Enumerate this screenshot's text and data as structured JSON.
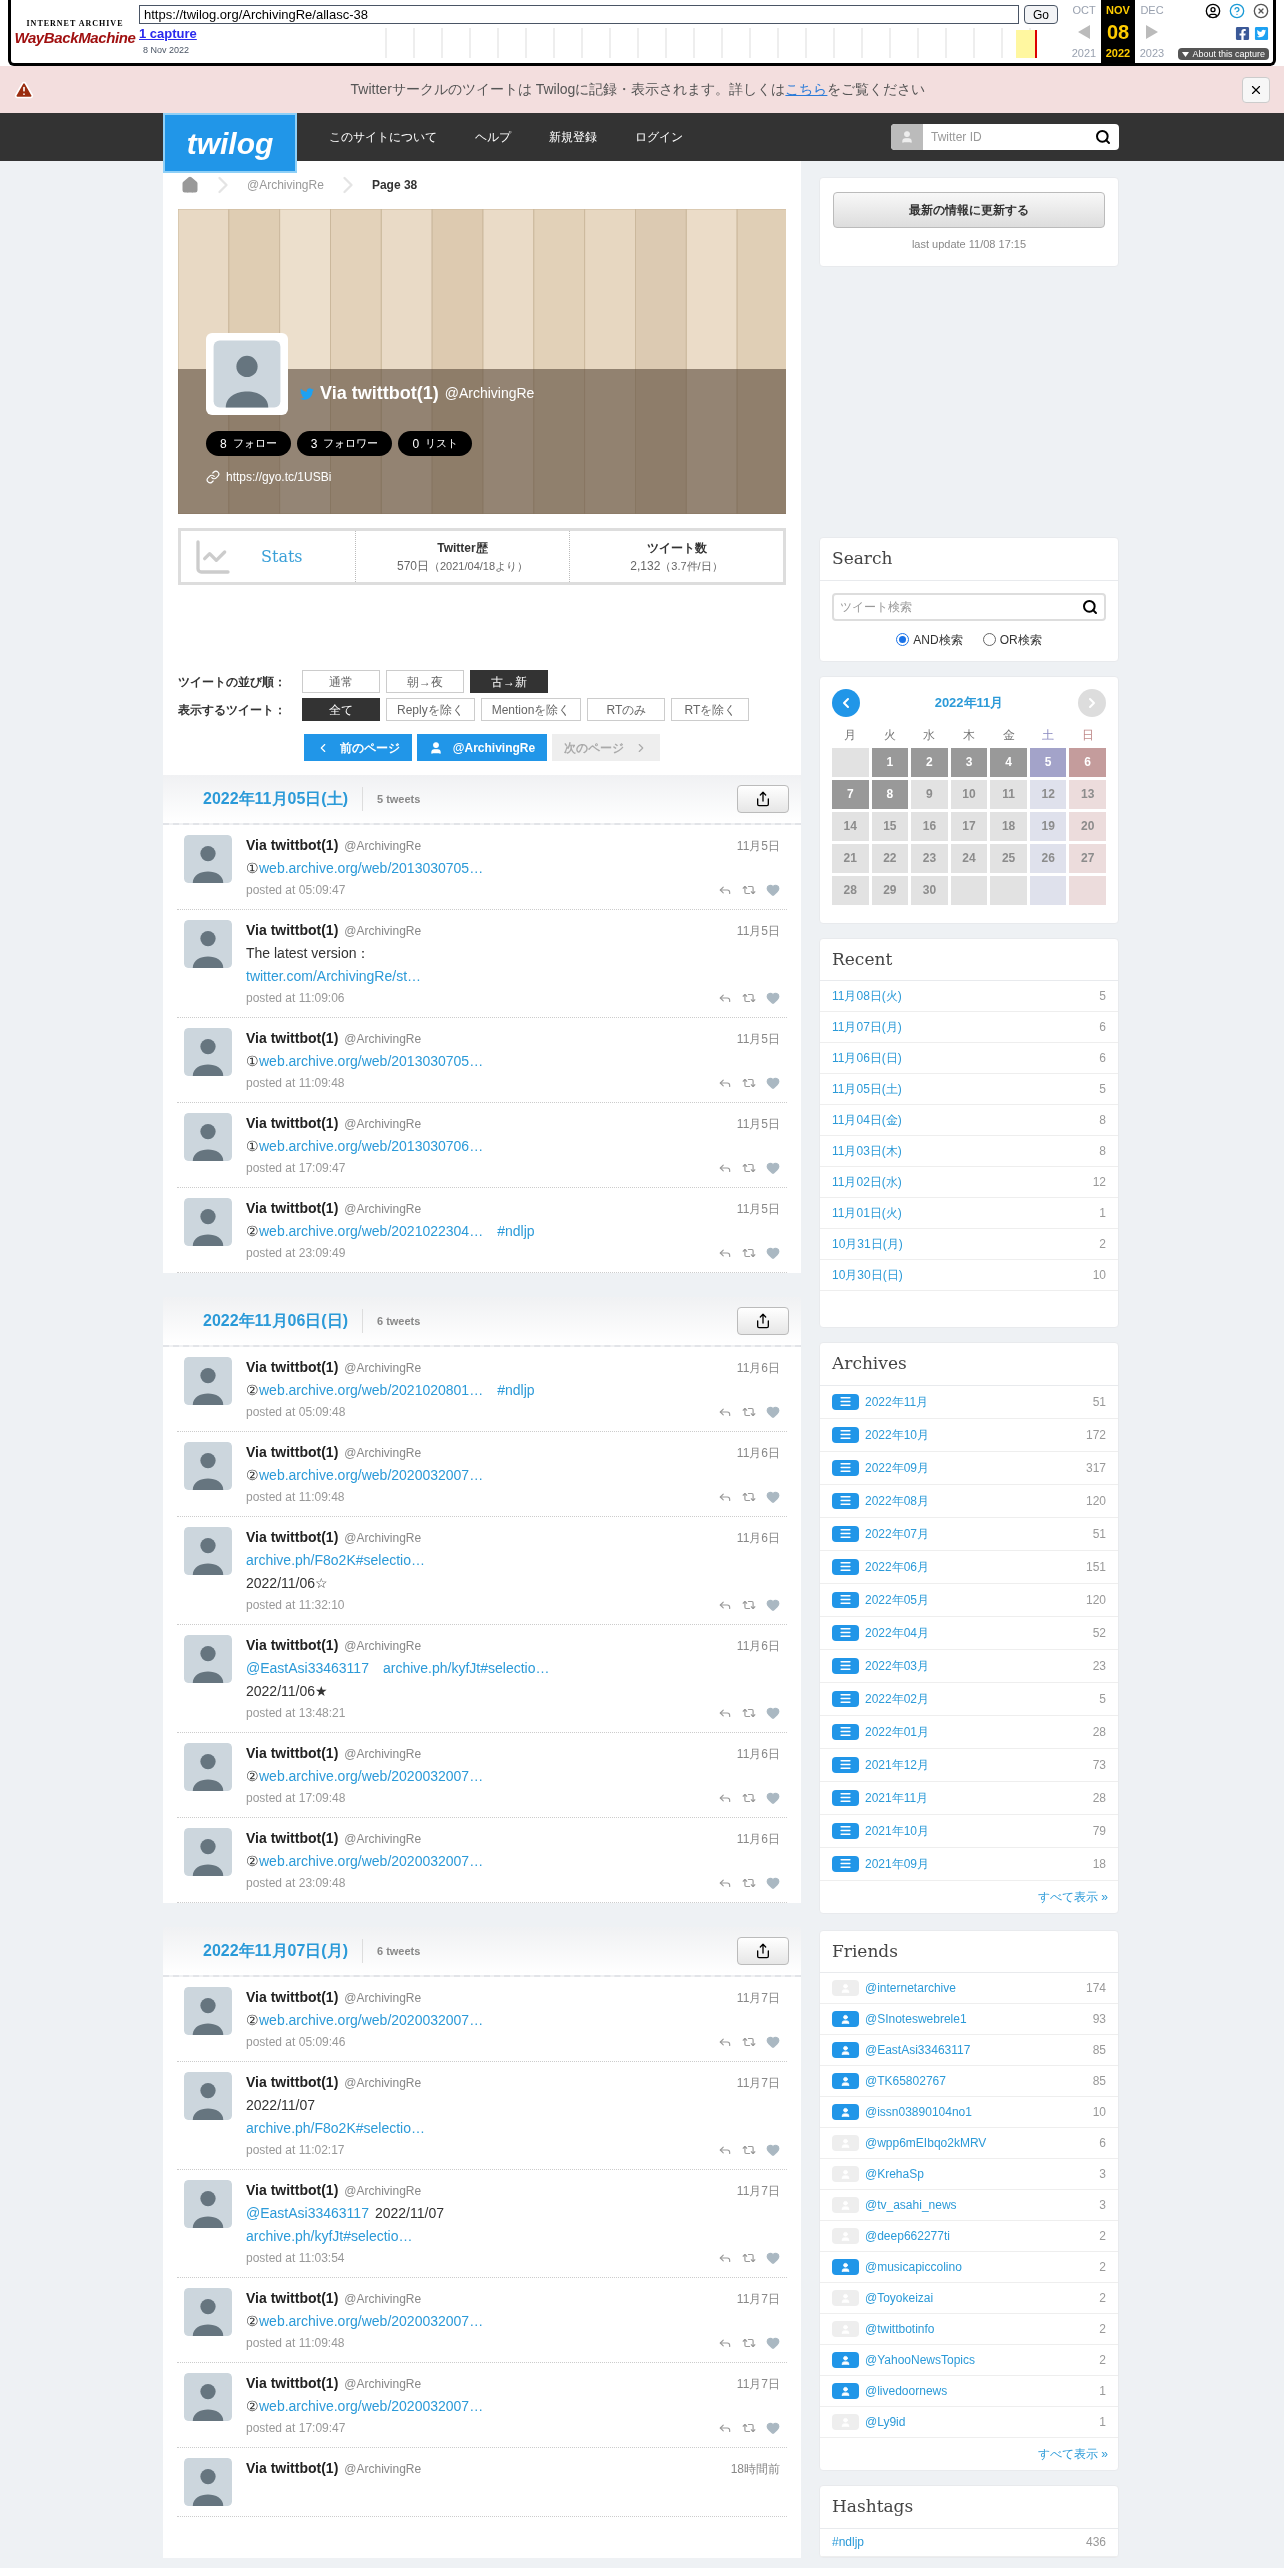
{
  "wayback": {
    "logo_top": "INTERNET ARCHIVE",
    "logo": "WayBackMachine",
    "url": "https://twilog.org/ArchivingRe/allasc-38",
    "go": "Go",
    "captures": "1 capture",
    "capture_date": "8 Nov 2022",
    "day": "08",
    "about": "About this capture",
    "months": [
      {
        "label": "OCT",
        "year": "2021",
        "selected": false
      },
      {
        "label": "NOV",
        "year": "2022",
        "selected": true
      },
      {
        "label": "DEC",
        "year": "2023",
        "selected": false
      }
    ]
  },
  "notice": {
    "before": "Twitterサークルのツイートは Twilogに記録・表示されます。詳しくは",
    "link": "こちら",
    "after": "をご覧ください"
  },
  "header": {
    "logo": "twilog",
    "nav": [
      "このサイトについて",
      "ヘルプ",
      "新規登録",
      "ログイン"
    ],
    "search_placeholder": "Twitter ID"
  },
  "breadcrumb": [
    "@ArchivingRe",
    "Page 38"
  ],
  "profile": {
    "name": "Via twittbot(1)",
    "handle": "@ArchivingRe",
    "url": "https://gyo.tc/1USBi",
    "counts": [
      {
        "value": "8",
        "label": "フォロー"
      },
      {
        "value": "3",
        "label": "フォロワー"
      },
      {
        "value": "0",
        "label": "リスト"
      }
    ]
  },
  "stats": {
    "title": "Stats",
    "items": [
      {
        "label": "Twitter歴",
        "value": "570日",
        "note": "（2021/04/18より）"
      },
      {
        "label": "ツイート数",
        "value": "2,132",
        "note": "（3.7件/日）"
      }
    ]
  },
  "sort": {
    "label": "ツイートの並び順：",
    "options": [
      {
        "label": "通常",
        "selected": false
      },
      {
        "label": "朝→夜",
        "selected": false
      },
      {
        "label": "古→新",
        "selected": true
      }
    ]
  },
  "filter": {
    "label": "表示するツイート：",
    "options": [
      {
        "label": "全て",
        "selected": true
      },
      {
        "label": "Replyを除く",
        "selected": false
      },
      {
        "label": "Mentionを除く",
        "selected": false
      },
      {
        "label": "RTのみ",
        "selected": false
      },
      {
        "label": "RTを除く",
        "selected": false
      }
    ]
  },
  "paging": [
    {
      "kind": "prev",
      "label": "前のページ",
      "disabled": false
    },
    {
      "kind": "user",
      "label": "@ArchivingRe",
      "disabled": false
    },
    {
      "kind": "next",
      "label": "次のページ",
      "disabled": true
    }
  ],
  "days": [
    {
      "date": "2022年11月05日(土)",
      "count": "5 tweets",
      "tweets": [
        {
          "name": "Via twittbot(1)",
          "handle": "@ArchivingRe",
          "date": "11月5日",
          "lines": [
            [
              {
                "text": "①",
                "link": false
              },
              {
                "text": "web.archive.org/web/2013030705…",
                "link": true
              }
            ]
          ],
          "time": "posted at 05:09:47"
        },
        {
          "name": "Via twittbot(1)",
          "handle": "@ArchivingRe",
          "date": "11月5日",
          "lines": [
            [
              {
                "text": "The latest version：",
                "link": false
              }
            ],
            [
              {
                "text": "twitter.com/ArchivingRe/st…",
                "link": true
              }
            ]
          ],
          "time": "posted at 11:09:06"
        },
        {
          "name": "Via twittbot(1)",
          "handle": "@ArchivingRe",
          "date": "11月5日",
          "lines": [
            [
              {
                "text": "①",
                "link": false
              },
              {
                "text": "web.archive.org/web/2013030705…",
                "link": true
              }
            ]
          ],
          "time": "posted at 11:09:48"
        },
        {
          "name": "Via twittbot(1)",
          "handle": "@ArchivingRe",
          "date": "11月5日",
          "lines": [
            [
              {
                "text": "①",
                "link": false
              },
              {
                "text": "web.archive.org/web/2013030706…",
                "link": true
              }
            ]
          ],
          "time": "posted at 17:09:47"
        },
        {
          "name": "Via twittbot(1)",
          "handle": "@ArchivingRe",
          "date": "11月5日",
          "lines": [
            [
              {
                "text": "②",
                "link": false
              },
              {
                "text": "web.archive.org/web/2021022304…",
                "link": true
              },
              {
                "text": "#ndljp",
                "link": true
              }
            ]
          ],
          "time": "posted at 23:09:49"
        }
      ]
    },
    {
      "date": "2022年11月06日(日)",
      "count": "6 tweets",
      "tweets": [
        {
          "name": "Via twittbot(1)",
          "handle": "@ArchivingRe",
          "date": "11月6日",
          "lines": [
            [
              {
                "text": "②",
                "link": false
              },
              {
                "text": "web.archive.org/web/2021020801…",
                "link": true
              },
              {
                "text": "#ndljp",
                "link": true
              }
            ]
          ],
          "time": "posted at 05:09:48"
        },
        {
          "name": "Via twittbot(1)",
          "handle": "@ArchivingRe",
          "date": "11月6日",
          "lines": [
            [
              {
                "text": "②",
                "link": false
              },
              {
                "text": "web.archive.org/web/2020032007…",
                "link": true
              }
            ]
          ],
          "time": "posted at 11:09:48"
        },
        {
          "name": "Via twittbot(1)",
          "handle": "@ArchivingRe",
          "date": "11月6日",
          "lines": [
            [
              {
                "text": "archive.ph/F8o2K#selectio…",
                "link": true
              }
            ],
            [
              {
                "text": "2022/11/06☆",
                "link": false
              }
            ]
          ],
          "time": "posted at 11:32:10"
        },
        {
          "name": "Via twittbot(1)",
          "handle": "@ArchivingRe",
          "date": "11月6日",
          "lines": [
            [
              {
                "text": "@EastAsi33463117",
                "link": true
              },
              {
                "text": "archive.ph/kyfJt#selectio…",
                "link": true
              }
            ],
            [
              {
                "text": "2022/11/06★",
                "link": false
              }
            ]
          ],
          "time": "posted at 13:48:21"
        },
        {
          "name": "Via twittbot(1)",
          "handle": "@ArchivingRe",
          "date": "11月6日",
          "lines": [
            [
              {
                "text": "②",
                "link": false
              },
              {
                "text": "web.archive.org/web/2020032007…",
                "link": true
              }
            ]
          ],
          "time": "posted at 17:09:48"
        },
        {
          "name": "Via twittbot(1)",
          "handle": "@ArchivingRe",
          "date": "11月6日",
          "lines": [
            [
              {
                "text": "②",
                "link": false
              },
              {
                "text": "web.archive.org/web/2020032007…",
                "link": true
              }
            ]
          ],
          "time": "posted at 23:09:48"
        }
      ]
    },
    {
      "date": "2022年11月07日(月)",
      "count": "6 tweets",
      "tweets": [
        {
          "name": "Via twittbot(1)",
          "handle": "@ArchivingRe",
          "date": "11月7日",
          "lines": [
            [
              {
                "text": "②",
                "link": false
              },
              {
                "text": "web.archive.org/web/2020032007…",
                "link": true
              }
            ]
          ],
          "time": "posted at 05:09:46"
        },
        {
          "name": "Via twittbot(1)",
          "handle": "@ArchivingRe",
          "date": "11月7日",
          "lines": [
            [
              {
                "text": "2022/11/07",
                "link": false
              }
            ],
            [
              {
                "text": "archive.ph/F8o2K#selectio…",
                "link": true
              }
            ]
          ],
          "time": "posted at 11:02:17"
        },
        {
          "name": "Via twittbot(1)",
          "handle": "@ArchivingRe",
          "date": "11月7日",
          "lines": [
            [
              {
                "text": "@EastAsi33463117",
                "link": true
              },
              {
                "text": "2022/11/07",
                "link": false
              }
            ],
            [
              {
                "text": "archive.ph/kyfJt#selectio…",
                "link": true
              }
            ]
          ],
          "time": "posted at 11:03:54"
        },
        {
          "name": "Via twittbot(1)",
          "handle": "@ArchivingRe",
          "date": "11月7日",
          "lines": [
            [
              {
                "text": "②",
                "link": false
              },
              {
                "text": "web.archive.org/web/2020032007…",
                "link": true
              }
            ]
          ],
          "time": "posted at 11:09:48"
        },
        {
          "name": "Via twittbot(1)",
          "handle": "@ArchivingRe",
          "date": "11月7日",
          "lines": [
            [
              {
                "text": "②",
                "link": false
              },
              {
                "text": "web.archive.org/web/2020032007…",
                "link": true
              }
            ]
          ],
          "time": "posted at 17:09:47"
        },
        {
          "name": "Via twittbot(1)",
          "handle": "@ArchivingRe",
          "date": "18時間前"
        }
      ]
    }
  ],
  "sidebar": {
    "refresh": {
      "button": "最新の情報に更新する",
      "note": "last update 11/08 17:15"
    },
    "search": {
      "title": "Search",
      "placeholder": "ツイート検索",
      "modes": [
        {
          "label": "AND検索",
          "selected": true
        },
        {
          "label": "OR検索",
          "selected": false
        }
      ]
    },
    "calendar": {
      "title": "2022年11月",
      "prev_disabled": false,
      "next_disabled": true,
      "weekdays": [
        "月",
        "火",
        "水",
        "木",
        "金",
        "土",
        "日"
      ],
      "cells": [
        {
          "active": false
        },
        {
          "label": "1",
          "active": true
        },
        {
          "label": "2",
          "active": true
        },
        {
          "label": "3",
          "active": true
        },
        {
          "label": "4",
          "active": true
        },
        {
          "label": "5",
          "active": true
        },
        {
          "label": "6",
          "active": true
        },
        {
          "label": "7",
          "active": true
        },
        {
          "label": "8",
          "active": true
        },
        {
          "label": "9",
          "active": false
        },
        {
          "label": "10",
          "active": false
        },
        {
          "label": "11",
          "active": false
        },
        {
          "label": "12",
          "active": false
        },
        {
          "label": "13",
          "active": false
        },
        {
          "label": "14",
          "active": false
        },
        {
          "label": "15",
          "active": false
        },
        {
          "label": "16",
          "active": false
        },
        {
          "label": "17",
          "active": false
        },
        {
          "label": "18",
          "active": false
        },
        {
          "label": "19",
          "active": false
        },
        {
          "label": "20",
          "active": false
        },
        {
          "label": "21",
          "active": false
        },
        {
          "label": "22",
          "active": false
        },
        {
          "label": "23",
          "active": false
        },
        {
          "label": "24",
          "active": false
        },
        {
          "label": "25",
          "active": false
        },
        {
          "label": "26",
          "active": false
        },
        {
          "label": "27",
          "active": false
        },
        {
          "label": "28",
          "active": false
        },
        {
          "label": "29",
          "active": false
        },
        {
          "label": "30",
          "active": false
        },
        {
          "active": false
        },
        {
          "active": false
        },
        {
          "active": false
        },
        {
          "active": false
        }
      ]
    },
    "recent": {
      "title": "Recent",
      "items": [
        {
          "label": "11月08日(火)",
          "count": "5"
        },
        {
          "label": "11月07日(月)",
          "count": "6"
        },
        {
          "label": "11月06日(日)",
          "count": "6"
        },
        {
          "label": "11月05日(土)",
          "count": "5"
        },
        {
          "label": "11月04日(金)",
          "count": "8"
        },
        {
          "label": "11月03日(木)",
          "count": "8"
        },
        {
          "label": "11月02日(水)",
          "count": "12"
        },
        {
          "label": "11月01日(火)",
          "count": "1"
        },
        {
          "label": "10月31日(月)",
          "count": "2"
        },
        {
          "label": "10月30日(日)",
          "count": "10"
        }
      ]
    },
    "archives": {
      "title": "Archives",
      "more": "すべて表示 »",
      "items": [
        {
          "label": "2022年11月",
          "count": "51"
        },
        {
          "label": "2022年10月",
          "count": "172"
        },
        {
          "label": "2022年09月",
          "count": "317"
        },
        {
          "label": "2022年08月",
          "count": "120"
        },
        {
          "label": "2022年07月",
          "count": "51"
        },
        {
          "label": "2022年06月",
          "count": "151"
        },
        {
          "label": "2022年05月",
          "count": "120"
        },
        {
          "label": "2022年04月",
          "count": "52"
        },
        {
          "label": "2022年03月",
          "count": "23"
        },
        {
          "label": "2022年02月",
          "count": "5"
        },
        {
          "label": "2022年01月",
          "count": "28"
        },
        {
          "label": "2021年12月",
          "count": "73"
        },
        {
          "label": "2021年11月",
          "count": "28"
        },
        {
          "label": "2021年10月",
          "count": "79"
        },
        {
          "label": "2021年09月",
          "count": "18"
        }
      ]
    },
    "friends": {
      "title": "Friends",
      "more": "すべて表示 »",
      "items": [
        {
          "label": "@internetarchive",
          "count": "174",
          "highlighted": false
        },
        {
          "label": "@SInoteswebrele1",
          "count": "93",
          "highlighted": true
        },
        {
          "label": "@EastAsi33463117",
          "count": "85",
          "highlighted": true
        },
        {
          "label": "@TK65802767",
          "count": "85",
          "highlighted": true
        },
        {
          "label": "@issn03890104no1",
          "count": "10",
          "highlighted": true
        },
        {
          "label": "@wpp6mEIbqo2kMRV",
          "count": "6",
          "highlighted": false
        },
        {
          "label": "@KrehaSp",
          "count": "3",
          "highlighted": false
        },
        {
          "label": "@tv_asahi_news",
          "count": "3",
          "highlighted": false
        },
        {
          "label": "@deep662277ti",
          "count": "2",
          "highlighted": false
        },
        {
          "label": "@musicapiccolino",
          "count": "2",
          "highlighted": true
        },
        {
          "label": "@Toyokeizai",
          "count": "2",
          "highlighted": false
        },
        {
          "label": "@twittbotinfo",
          "count": "2",
          "highlighted": false
        },
        {
          "label": "@YahooNewsTopics",
          "count": "2",
          "highlighted": true
        },
        {
          "label": "@livedoornews",
          "count": "1",
          "highlighted": true
        },
        {
          "label": "@Ly9id",
          "count": "1",
          "highlighted": false
        }
      ]
    },
    "hashtags": {
      "title": "Hashtags",
      "items": [
        {
          "label": "#ndljp",
          "count": "436"
        }
      ]
    }
  }
}
